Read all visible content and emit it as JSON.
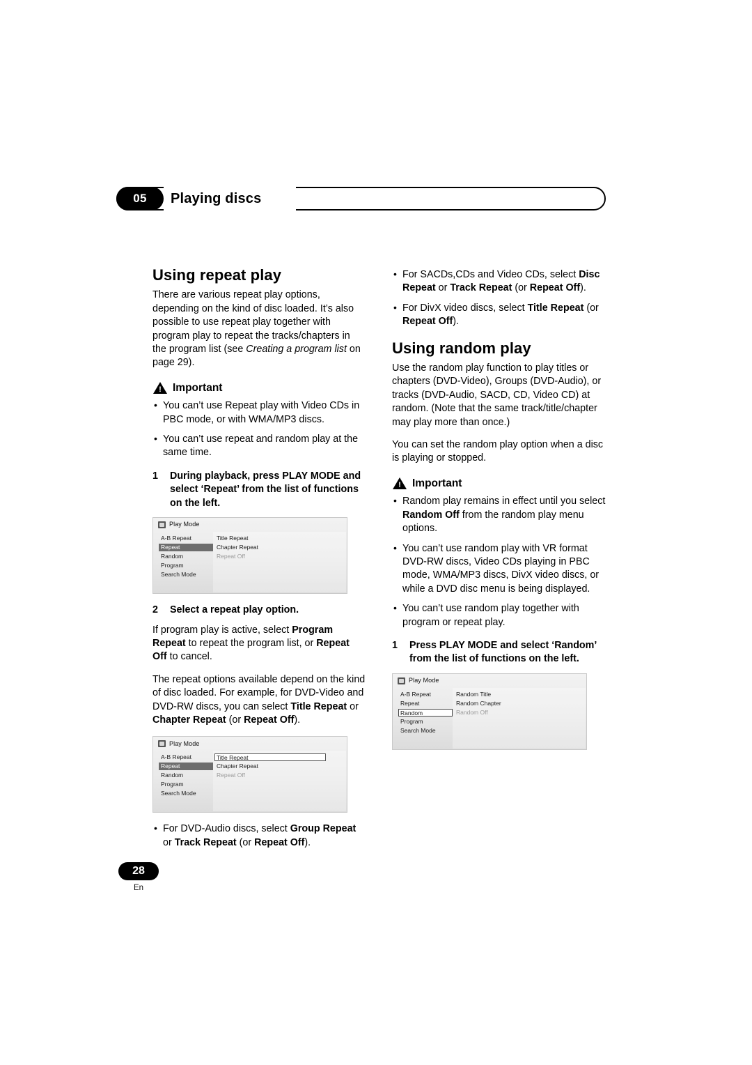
{
  "header": {
    "chapter_number": "05",
    "title": "Playing discs"
  },
  "left_column": {
    "section_title": "Using repeat play",
    "intro_part1": "There are various repeat play options, depending on the kind of disc loaded. It’s also possible to use repeat play together with program play to repeat the tracks/chapters in the program list (see ",
    "intro_italic": "Creating a program list",
    "intro_part2": " on page 29).",
    "important_label": "Important",
    "important_bullets": [
      "You can’t use Repeat play with Video CDs in PBC mode, or with WMA/MP3 discs.",
      "You can’t use repeat and random play at the same time."
    ],
    "step1_num": "1",
    "step1_text": "During playback, press PLAY MODE and select ‘Repeat’ from the list of functions on the left.",
    "step2_num": "2",
    "step2_text": "Select a repeat play option.",
    "para_program_1": "If program play is active, select ",
    "para_program_b1": "Program Repeat",
    "para_program_2": " to repeat the program list, or ",
    "para_program_b2": "Repeat Off",
    "para_program_3": " to cancel.",
    "para_options_1": "The repeat options available depend on the kind of disc loaded. For example, for DVD-Video and DVD-RW discs, you can select ",
    "para_options_b1": "Title Repeat",
    "para_options_2": " or ",
    "para_options_b2": "Chapter Repeat",
    "para_options_3": " (or ",
    "para_options_b3": "Repeat Off",
    "para_options_4": ").",
    "bullet_dvda_1": "For DVD-Audio discs, select ",
    "bullet_dvda_b1": "Group Repeat",
    "bullet_dvda_2": " or ",
    "bullet_dvda_b2": "Track Repeat",
    "bullet_dvda_3": " (or ",
    "bullet_dvda_b3": "Repeat Off",
    "bullet_dvda_4": ")."
  },
  "right_column": {
    "bullet_sacd_1": "For SACDs,CDs and Video CDs, select ",
    "bullet_sacd_b1": "Disc Repeat",
    "bullet_sacd_2": " or ",
    "bullet_sacd_b2": "Track Repeat",
    "bullet_sacd_3": " (or ",
    "bullet_sacd_b3": "Repeat Off",
    "bullet_sacd_4": ").",
    "bullet_divx_1": "For DivX video discs, select ",
    "bullet_divx_b1": "Title Repeat",
    "bullet_divx_2": " (or ",
    "bullet_divx_b2": "Repeat Off",
    "bullet_divx_3": ").",
    "section_title": "Using random play",
    "intro": "Use the random play function to play titles or chapters (DVD-Video), Groups (DVD-Audio), or tracks (DVD-Audio, SACD, CD, Video CD) at random. (Note that the same track/title/chapter may play more than once.)",
    "intro2": "You can set the random play option when a disc is playing or stopped.",
    "important_label": "Important",
    "important_bullet1_1": "Random play remains in effect until you select ",
    "important_bullet1_b1": "Random Off",
    "important_bullet1_2": " from the random play menu options.",
    "important_bullet2": "You can’t use random play with VR format DVD-RW discs, Video CDs playing in PBC mode, WMA/MP3 discs, DivX video discs, or while a DVD disc menu is being displayed.",
    "important_bullet3": "You can’t use random play together with program or repeat play.",
    "step1_num": "1",
    "step1_text": "Press PLAY MODE and select ‘Random’ from the list of functions on the left."
  },
  "osd_screens": {
    "repeat_dark": {
      "title": "Play Mode",
      "left_items": [
        "A-B Repeat",
        "Repeat",
        "Random",
        "Program",
        "Search Mode"
      ],
      "left_selected_index": 1,
      "right_items": [
        "Title Repeat",
        "Chapter Repeat",
        "Repeat Off"
      ],
      "right_dim_index": 2
    },
    "repeat_light": {
      "title": "Play Mode",
      "left_items": [
        "A-B Repeat",
        "Repeat",
        "Random",
        "Program",
        "Search Mode"
      ],
      "left_selected_index": 1,
      "right_items": [
        "Title Repeat",
        "Chapter Repeat",
        "Repeat Off"
      ],
      "right_highlight_index": 0,
      "right_dim_index": 2
    },
    "random": {
      "title": "Play Mode",
      "left_items": [
        "A-B Repeat",
        "Repeat",
        "Random",
        "Program",
        "Search Mode"
      ],
      "left_selected_index": 2,
      "right_items": [
        "Random Title",
        "Random Chapter",
        "Random Off"
      ],
      "right_dim_index": 2
    }
  },
  "footer": {
    "page_number": "28",
    "language": "En"
  }
}
